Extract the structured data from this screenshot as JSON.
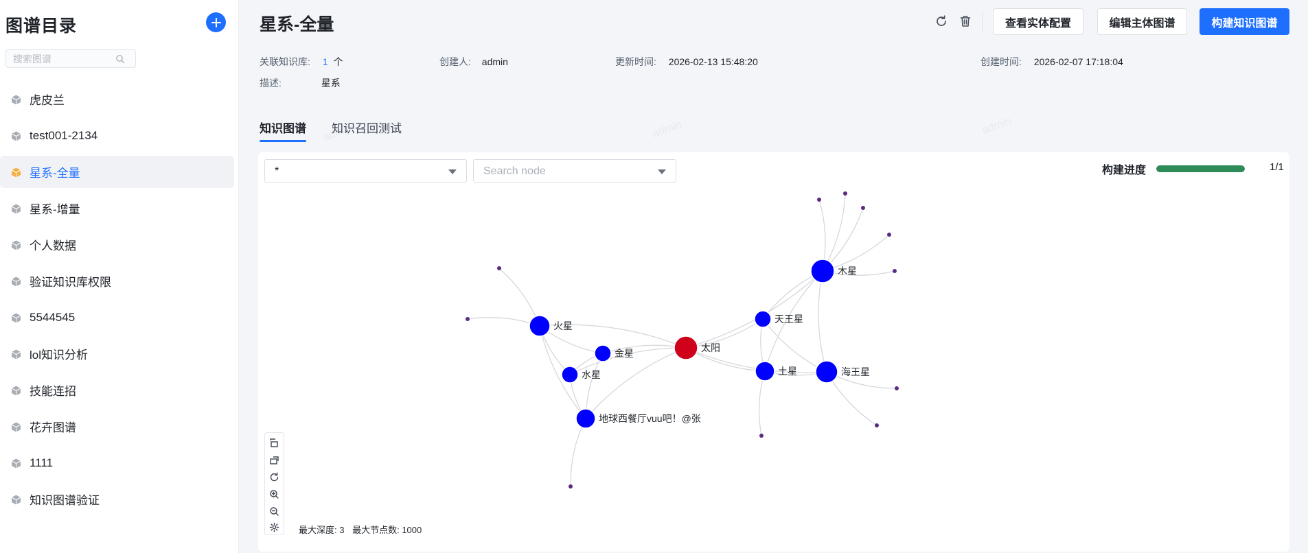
{
  "sidebar": {
    "title": "图谱目录",
    "search_placeholder": "搜索图谱",
    "items": [
      {
        "label": "虎皮兰",
        "active": false
      },
      {
        "label": "test001-2134",
        "active": false
      },
      {
        "label": "星系-全量",
        "active": true
      },
      {
        "label": "星系-增量",
        "active": false
      },
      {
        "label": "个人数据",
        "active": false
      },
      {
        "label": "验证知识库权限",
        "active": false
      },
      {
        "label": "5544545",
        "active": false
      },
      {
        "label": "lol知识分析",
        "active": false
      },
      {
        "label": "技能连招",
        "active": false
      },
      {
        "label": "花卉图谱",
        "active": false
      },
      {
        "label": "1111",
        "active": false
      },
      {
        "label": "知识图谱验证",
        "active": false
      }
    ]
  },
  "header": {
    "title": "星系-全量",
    "buttons": {
      "view_entity": "查看实体配置",
      "edit_schema": "编辑主体图谱",
      "build": "构建知识图谱"
    }
  },
  "meta": {
    "kb_label": "关联知识库:",
    "kb_count": "1",
    "kb_unit": "个",
    "creator_label": "创建人:",
    "creator": "admin",
    "updated_label": "更新时间:",
    "updated": "2026-02-13 15:48:20",
    "created_label": "创建时间:",
    "created": "2026-02-07 17:18:04",
    "desc_label": "描述:",
    "desc": "星系"
  },
  "tabs": [
    "知识图谱",
    "知识召回测试"
  ],
  "graph": {
    "filter_value": "*",
    "search_placeholder": "Search node",
    "progress_label": "构建进度",
    "progress_fraction": 1.0,
    "progress_count": "1/1",
    "max_depth_label": "最大深度: 3",
    "max_nodes_label": "最大节点数: 1000",
    "watermark": "admin",
    "colors": {
      "center": "#d0021b",
      "node": "#0000ff",
      "leaf": "#5a2a82",
      "edge": "#d6d8dc"
    },
    "nodes": [
      {
        "id": "sun",
        "label": "太阳",
        "kind": "center"
      },
      {
        "id": "jupiter",
        "label": "木星",
        "kind": "node"
      },
      {
        "id": "uranus",
        "label": "天王星",
        "kind": "node"
      },
      {
        "id": "mars",
        "label": "火星",
        "kind": "node"
      },
      {
        "id": "venus",
        "label": "金星",
        "kind": "node"
      },
      {
        "id": "mercury",
        "label": "水星",
        "kind": "node"
      },
      {
        "id": "saturn",
        "label": "土星",
        "kind": "node"
      },
      {
        "id": "neptune",
        "label": "海王星",
        "kind": "node"
      },
      {
        "id": "earth",
        "label": "地球西餐厅vuu吧！@张",
        "kind": "node"
      },
      {
        "id": "l1",
        "label": "",
        "kind": "leaf"
      },
      {
        "id": "l2",
        "label": "",
        "kind": "leaf"
      },
      {
        "id": "l3",
        "label": "",
        "kind": "leaf"
      },
      {
        "id": "l4",
        "label": "",
        "kind": "leaf"
      },
      {
        "id": "l5",
        "label": "",
        "kind": "leaf"
      },
      {
        "id": "l6",
        "label": "",
        "kind": "leaf"
      },
      {
        "id": "l7",
        "label": "",
        "kind": "leaf"
      },
      {
        "id": "l8",
        "label": "",
        "kind": "leaf"
      },
      {
        "id": "l9",
        "label": "",
        "kind": "leaf"
      },
      {
        "id": "l10",
        "label": "",
        "kind": "leaf"
      },
      {
        "id": "l11",
        "label": "",
        "kind": "leaf"
      }
    ],
    "edges": [
      [
        "sun",
        "jupiter"
      ],
      [
        "sun",
        "uranus"
      ],
      [
        "sun",
        "saturn"
      ],
      [
        "sun",
        "neptune"
      ],
      [
        "sun",
        "venus"
      ],
      [
        "sun",
        "mercury"
      ],
      [
        "sun",
        "earth"
      ],
      [
        "sun",
        "mars"
      ],
      [
        "jupiter",
        "uranus"
      ],
      [
        "jupiter",
        "saturn"
      ],
      [
        "jupiter",
        "neptune"
      ],
      [
        "uranus",
        "saturn"
      ],
      [
        "uranus",
        "neptune"
      ],
      [
        "saturn",
        "neptune"
      ],
      [
        "mars",
        "venus"
      ],
      [
        "mars",
        "mercury"
      ],
      [
        "mars",
        "earth"
      ],
      [
        "venus",
        "mercury"
      ],
      [
        "venus",
        "earth"
      ],
      [
        "mercury",
        "earth"
      ],
      [
        "jupiter",
        "l1"
      ],
      [
        "jupiter",
        "l2"
      ],
      [
        "jupiter",
        "l3"
      ],
      [
        "jupiter",
        "l4"
      ],
      [
        "mars",
        "l5"
      ],
      [
        "mars",
        "l6"
      ],
      [
        "earth",
        "l7"
      ],
      [
        "saturn",
        "l8"
      ],
      [
        "neptune",
        "l9"
      ],
      [
        "neptune",
        "l10"
      ],
      [
        "jupiter",
        "l11"
      ]
    ]
  }
}
